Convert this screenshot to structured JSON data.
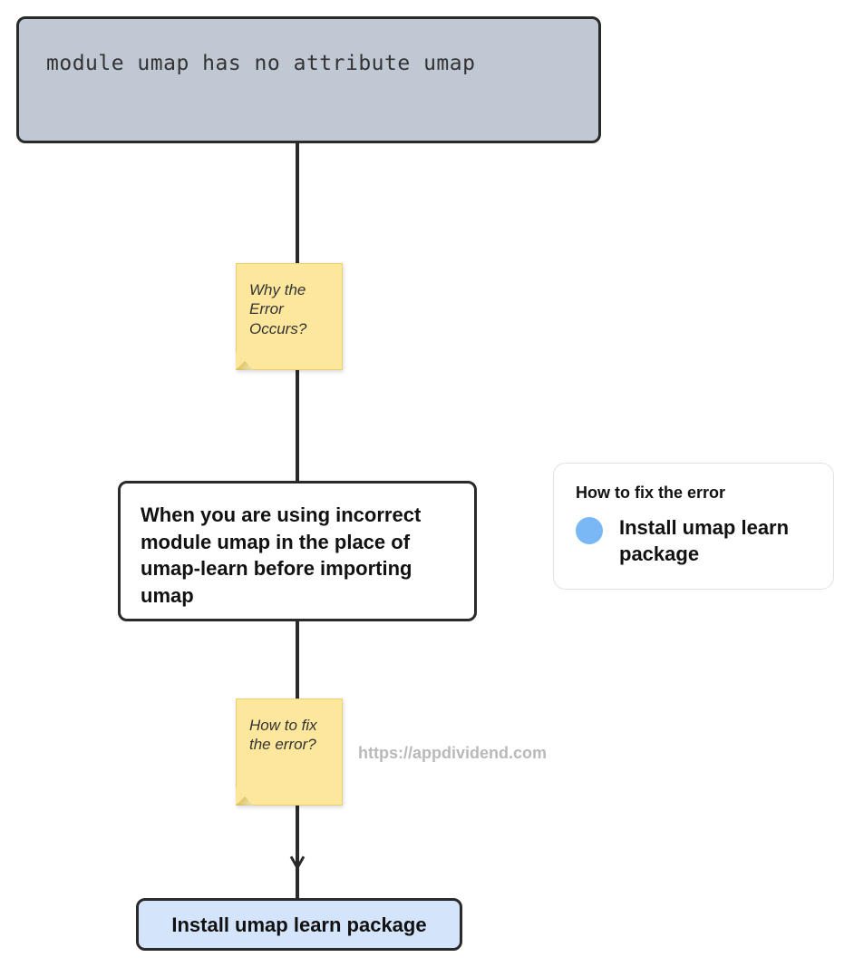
{
  "error_message": "module umap has no attribute umap",
  "sticky_why": "Why the Error Occurs?",
  "sticky_how": "How to fix the error?",
  "explanation": "When you are using incorrect module umap in the place of umap-learn before importing umap",
  "solution": "Install umap learn package",
  "legend": {
    "title": "How to fix the error",
    "item": "Install umap learn package"
  },
  "watermark": "https://appdividend.com"
}
